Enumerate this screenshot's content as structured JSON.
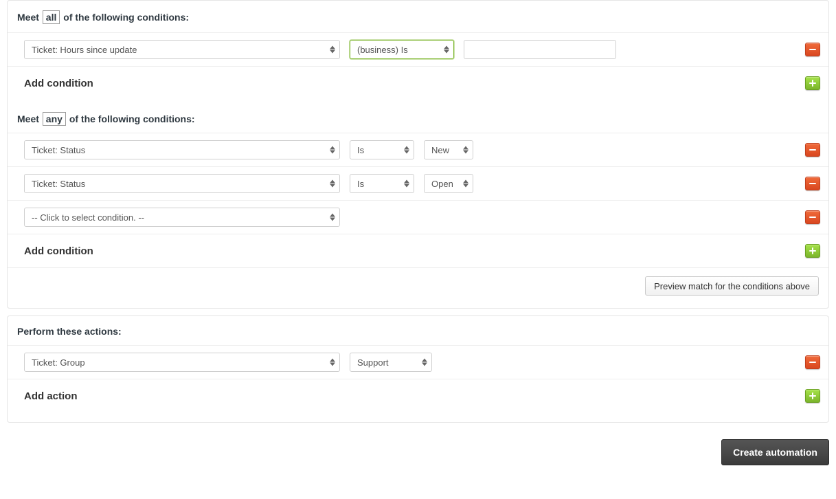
{
  "conditions": {
    "all": {
      "prefix": "Meet",
      "qualifier": "all",
      "suffix": "of the following conditions:",
      "rows": [
        {
          "field": "Ticket: Hours since update",
          "operator": "(business) Is",
          "value": "",
          "highlightOperator": true
        }
      ],
      "addLabel": "Add condition"
    },
    "any": {
      "prefix": "Meet",
      "qualifier": "any",
      "suffix": "of the following conditions:",
      "rows": [
        {
          "field": "Ticket: Status",
          "operator": "Is",
          "value": "New"
        },
        {
          "field": "Ticket: Status",
          "operator": "Is",
          "value": "Open"
        },
        {
          "field": "-- Click to select condition. --"
        }
      ],
      "addLabel": "Add condition"
    },
    "previewLabel": "Preview match for the conditions above"
  },
  "actions": {
    "heading": "Perform these actions:",
    "rows": [
      {
        "field": "Ticket: Group",
        "value": "Support"
      }
    ],
    "addLabel": "Add action"
  },
  "footer": {
    "submitLabel": "Create automation"
  }
}
